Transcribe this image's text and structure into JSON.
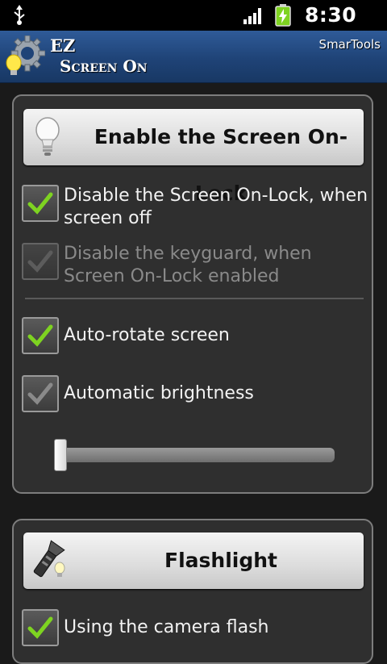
{
  "status_bar": {
    "time": "8:30 PM",
    "icons": [
      "usb-icon",
      "signal-icon",
      "battery-charging-icon"
    ]
  },
  "title_bar": {
    "title_line1": "EZ",
    "title_line2": "Screen On",
    "brand": "SmarTools",
    "logo_icon": "gear-bulb-icon"
  },
  "screen_lock": {
    "button_label": "Enable the Screen On-Lock",
    "button_icon": "lightbulb-icon",
    "options": [
      {
        "label": "Disable the Screen On-Lock, when screen off",
        "checked": true,
        "enabled": true
      },
      {
        "label": "Disable the keyguard, when Screen On-Lock enabled",
        "checked": true,
        "enabled": false
      },
      {
        "label": "Auto-rotate screen",
        "checked": true,
        "enabled": true
      },
      {
        "label": "Automatic brightness",
        "checked": false,
        "enabled": true
      }
    ],
    "brightness_level": 0
  },
  "flashlight": {
    "button_label": "Flashlight",
    "button_icon": "flashlight-icon",
    "options": [
      {
        "label": "Using the camera flash",
        "checked": true,
        "enabled": true
      }
    ]
  },
  "colors": {
    "check_green": "#7ed321",
    "title_bar": "#1f4377",
    "panel_bg": "#2f2f2f"
  }
}
